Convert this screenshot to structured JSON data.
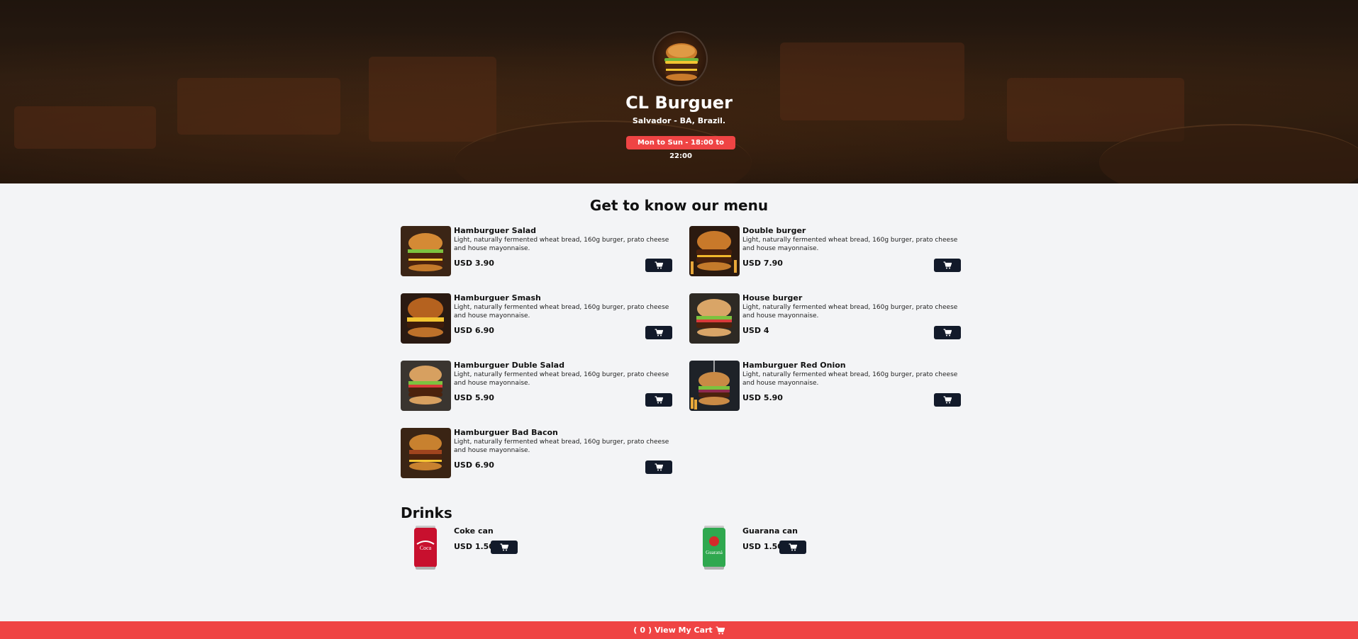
{
  "header": {
    "store_name": "CL Burguer",
    "location": "Salvador - BA, Brazil.",
    "hours": "Mon to Sun - 18:00 to 22:00",
    "logo_icon": "burger-logo"
  },
  "menu": {
    "title": "Get to know our menu",
    "items": [
      {
        "name": "Hamburguer Salad",
        "description": "Light, naturally fermented wheat bread, 160g burger, prato cheese and house mayonnaise.",
        "price": "USD 3.90"
      },
      {
        "name": "Double burger",
        "description": "Light, naturally fermented wheat bread, 160g burger, prato cheese and house mayonnaise.",
        "price": "USD 7.90"
      },
      {
        "name": "Hamburguer Smash",
        "description": "Light, naturally fermented wheat bread, 160g burger, prato cheese and house mayonnaise.",
        "price": "USD 6.90"
      },
      {
        "name": "House burger",
        "description": "Light, naturally fermented wheat bread, 160g burger, prato cheese and house mayonnaise.",
        "price": "USD 4"
      },
      {
        "name": "Hamburguer Duble Salad",
        "description": "Light, naturally fermented wheat bread, 160g burger, prato cheese and house mayonnaise.",
        "price": "USD 5.90"
      },
      {
        "name": "Hamburguer Red Onion",
        "description": "Light, naturally fermented wheat bread, 160g burger, prato cheese and house mayonnaise.",
        "price": "USD 5.90"
      },
      {
        "name": "Hamburguer Bad Bacon",
        "description": "Light, naturally fermented wheat bread, 160g burger, prato cheese and house mayonnaise.",
        "price": "USD 6.90"
      }
    ]
  },
  "drinks": {
    "title": "Drinks",
    "items": [
      {
        "name": "Coke can",
        "price": "USD 1.50",
        "color": "#c8102e"
      },
      {
        "name": "Guarana can",
        "price": "USD 1.50",
        "color": "#2fa84f"
      }
    ]
  },
  "footer": {
    "open_paren": "(",
    "count": "0",
    "close_paren": ")",
    "label": "View My Cart"
  },
  "colors": {
    "accent": "#ef4444",
    "button": "#121a2a",
    "background": "#f3f4f6"
  },
  "icons": {
    "cart": "shopping-cart-icon"
  }
}
